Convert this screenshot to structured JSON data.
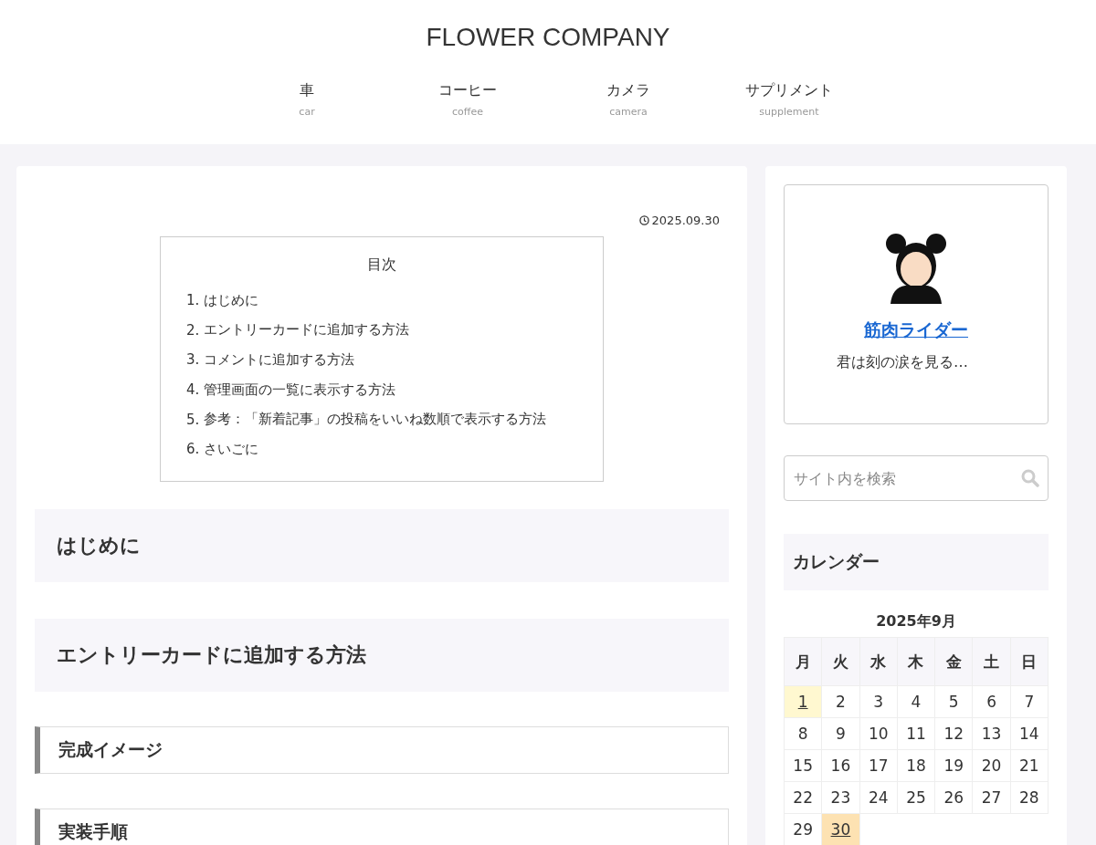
{
  "site_title": "FLOWER COMPANY",
  "nav": [
    {
      "label": "車",
      "sub": "car"
    },
    {
      "label": "コーヒー",
      "sub": "coffee"
    },
    {
      "label": "カメラ",
      "sub": "camera"
    },
    {
      "label": "サプリメント",
      "sub": "supplement"
    }
  ],
  "post": {
    "date": "2025.09.30",
    "toc": {
      "title": "目次",
      "items": [
        {
          "number": "1.",
          "label": "はじめに"
        },
        {
          "number": "2.",
          "label": "エントリーカードに追加する方法"
        },
        {
          "number": "3.",
          "label": "コメントに追加する方法"
        },
        {
          "number": "4.",
          "label": "管理画面の一覧に表示する方法"
        },
        {
          "number": "5.",
          "label": "参考：「新着記事」の投稿をいいね数順で表示する方法"
        },
        {
          "number": "6.",
          "label": "さいごに"
        }
      ]
    },
    "headings": [
      {
        "kind": "h2",
        "text": "はじめに"
      },
      {
        "kind": "h2",
        "text": "エントリーカードに追加する方法"
      },
      {
        "kind": "h3",
        "text": "完成イメージ"
      },
      {
        "kind": "h3",
        "text": "実装手順"
      }
    ]
  },
  "profile": {
    "name": "筋肉ライダー",
    "bio": "君は刻の涙を見る…"
  },
  "search": {
    "placeholder": "サイト内を検索"
  },
  "calendar": {
    "widget_title": "カレンダー",
    "caption": "2025年9月",
    "weekdays": [
      "月",
      "火",
      "水",
      "木",
      "金",
      "土",
      "日"
    ],
    "weeks": [
      [
        {
          "day": "1",
          "kind": "post"
        },
        {
          "day": "2",
          "kind": "plain"
        },
        {
          "day": "3",
          "kind": "plain"
        },
        {
          "day": "4",
          "kind": "plain"
        },
        {
          "day": "5",
          "kind": "plain"
        },
        {
          "day": "6",
          "kind": "plain"
        },
        {
          "day": "7",
          "kind": "plain"
        }
      ],
      [
        {
          "day": "8",
          "kind": "plain"
        },
        {
          "day": "9",
          "kind": "plain"
        },
        {
          "day": "10",
          "kind": "plain"
        },
        {
          "day": "11",
          "kind": "plain"
        },
        {
          "day": "12",
          "kind": "plain"
        },
        {
          "day": "13",
          "kind": "plain"
        },
        {
          "day": "14",
          "kind": "plain"
        }
      ],
      [
        {
          "day": "15",
          "kind": "plain"
        },
        {
          "day": "16",
          "kind": "plain"
        },
        {
          "day": "17",
          "kind": "plain"
        },
        {
          "day": "18",
          "kind": "plain"
        },
        {
          "day": "19",
          "kind": "plain"
        },
        {
          "day": "20",
          "kind": "plain"
        },
        {
          "day": "21",
          "kind": "plain"
        }
      ],
      [
        {
          "day": "22",
          "kind": "plain"
        },
        {
          "day": "23",
          "kind": "plain"
        },
        {
          "day": "24",
          "kind": "plain"
        },
        {
          "day": "25",
          "kind": "plain"
        },
        {
          "day": "26",
          "kind": "plain"
        },
        {
          "day": "27",
          "kind": "plain"
        },
        {
          "day": "28",
          "kind": "plain"
        }
      ],
      [
        {
          "day": "29",
          "kind": "plain"
        },
        {
          "day": "30",
          "kind": "today"
        }
      ]
    ]
  }
}
